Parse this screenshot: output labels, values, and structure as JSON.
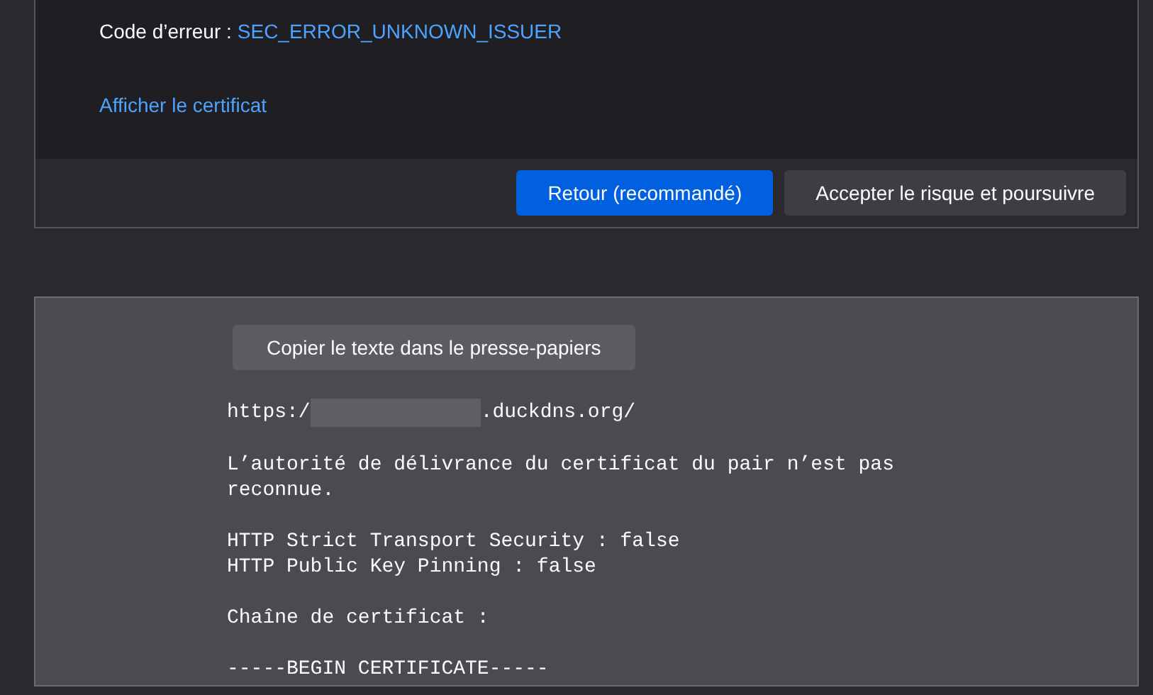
{
  "error_panel": {
    "error_code_label": "Code d’erreur :",
    "error_code": "SEC_ERROR_UNKNOWN_ISSUER",
    "view_certificate_link": "Afficher le certificat",
    "buttons": [
      {
        "label": "Retour (recommandé)",
        "kind": "primary"
      },
      {
        "label": "Accepter le risque et poursuivre",
        "kind": "secondary"
      }
    ]
  },
  "details_panel": {
    "copy_button": "Copier le texte dans le presse-papiers",
    "url_prefix": "https:/",
    "url_suffix": ".duckdns.org/",
    "paragraphs": [
      [
        "L’autorité de délivrance du certificat du pair n’est pas reconnue."
      ],
      [
        "HTTP Strict Transport Security : false",
        "HTTP Public Key Pinning : false"
      ],
      [
        "Chaîne de certificat :"
      ],
      [
        "-----BEGIN CERTIFICATE-----"
      ]
    ]
  }
}
